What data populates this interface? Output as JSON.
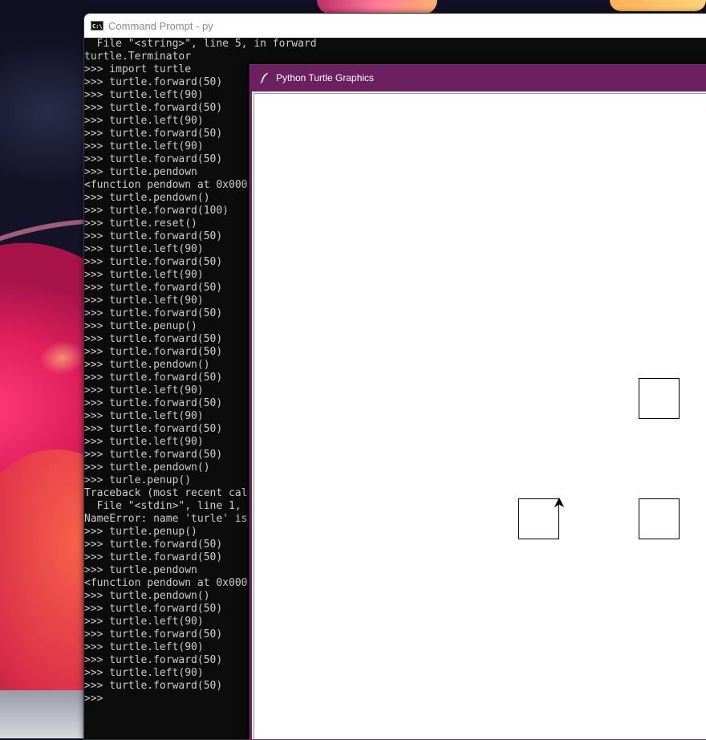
{
  "cmd_window": {
    "title": "Command Prompt - py",
    "icon_label": "C:\\."
  },
  "console_lines": [
    "  File \"<string>\", line 5, in forward",
    "turtle.Terminator",
    ">>> import turtle",
    ">>> turtle.forward(50)",
    ">>> turtle.left(90)",
    ">>> turtle.forward(50)",
    ">>> turtle.left(90)",
    ">>> turtle.forward(50)",
    ">>> turtle.left(90)",
    ">>> turtle.forward(50)",
    ">>> turtle.pendown",
    "<function pendown at 0x000",
    ">>> turtle.pendown()",
    ">>> turtle.forward(100)",
    ">>> turtle.reset()",
    ">>> turtle.forward(50)",
    ">>> turtle.left(90)",
    ">>> turtle.forward(50)",
    ">>> turtle.left(90)",
    ">>> turtle.forward(50)",
    ">>> turtle.left(90)",
    ">>> turtle.forward(50)",
    ">>> turtle.penup()",
    ">>> turtle.forward(50)",
    ">>> turtle.forward(50)",
    ">>> turtle.pendown()",
    ">>> turtle.forward(50)",
    ">>> turtle.left(90)",
    ">>> turtle.forward(50)",
    ">>> turtle.left(90)",
    ">>> turtle.forward(50)",
    ">>> turtle.left(90)",
    ">>> turtle.forward(50)",
    ">>> turtle.pendown()",
    ">>> turle.penup()",
    "Traceback (most recent cal",
    "  File \"<stdin>\", line 1,",
    "NameError: name 'turle' is",
    ">>> turtle.penup()",
    ">>> turtle.forward(50)",
    ">>> turtle.forward(50)",
    ">>> turtle.pendown",
    "<function pendown at 0x000",
    ">>> turtle.pendown()",
    ">>> turtle.forward(50)",
    ">>> turtle.left(90)",
    ">>> turtle.forward(50)",
    ">>> turtle.left(90)",
    ">>> turtle.forward(50)",
    ">>> turtle.left(90)",
    ">>> turtle.forward(50)",
    ">>>"
  ],
  "turtle_window": {
    "title": "Python Turtle Graphics",
    "icon": "feather-icon",
    "squares_count": 3,
    "turtle_heading": "up"
  },
  "colors": {
    "turtle_titlebar": "#6b2160",
    "console_bg": "#0c0c0c",
    "console_text": "#cccccc"
  }
}
